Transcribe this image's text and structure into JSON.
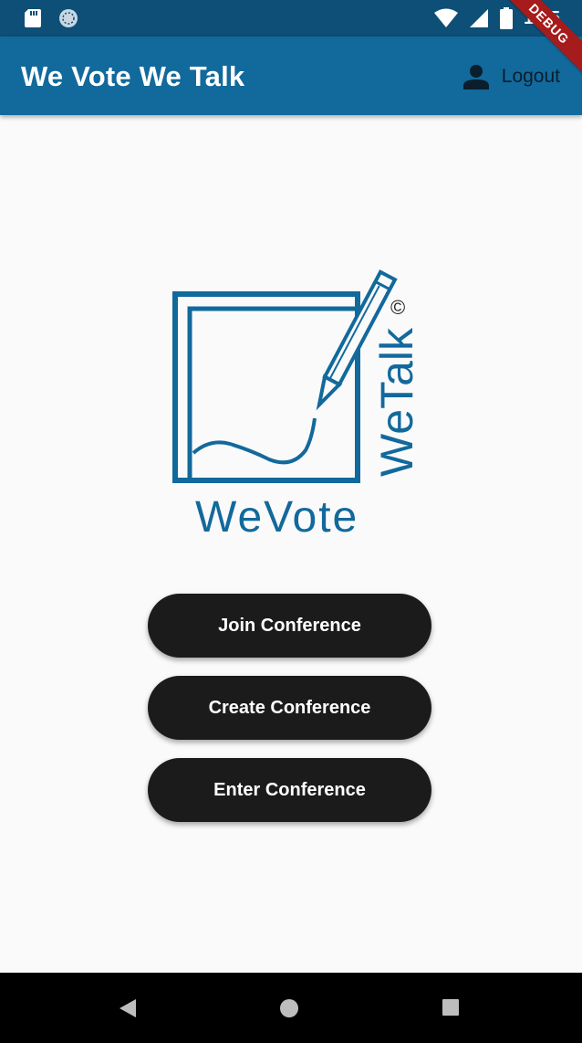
{
  "status_bar": {
    "time": "1:45",
    "left_icons": [
      "sd-card-icon",
      "sync-icon"
    ],
    "right_icons": [
      "wifi-icon",
      "signal-icon",
      "battery-icon"
    ]
  },
  "app_bar": {
    "title": "We Vote We Talk",
    "logout_label": "Logout",
    "logout_icon": "person-icon",
    "color": "#12699c"
  },
  "debug_banner": "DEBUG",
  "logo": {
    "text_primary": "WeVote",
    "text_secondary": "WeTalk",
    "mark": "©",
    "color": "#12699c"
  },
  "buttons": {
    "join": "Join Conference",
    "create": "Create Conference",
    "enter": "Enter Conference"
  },
  "nav_bar": {
    "icons": [
      "back-icon",
      "home-icon",
      "recents-icon"
    ]
  }
}
